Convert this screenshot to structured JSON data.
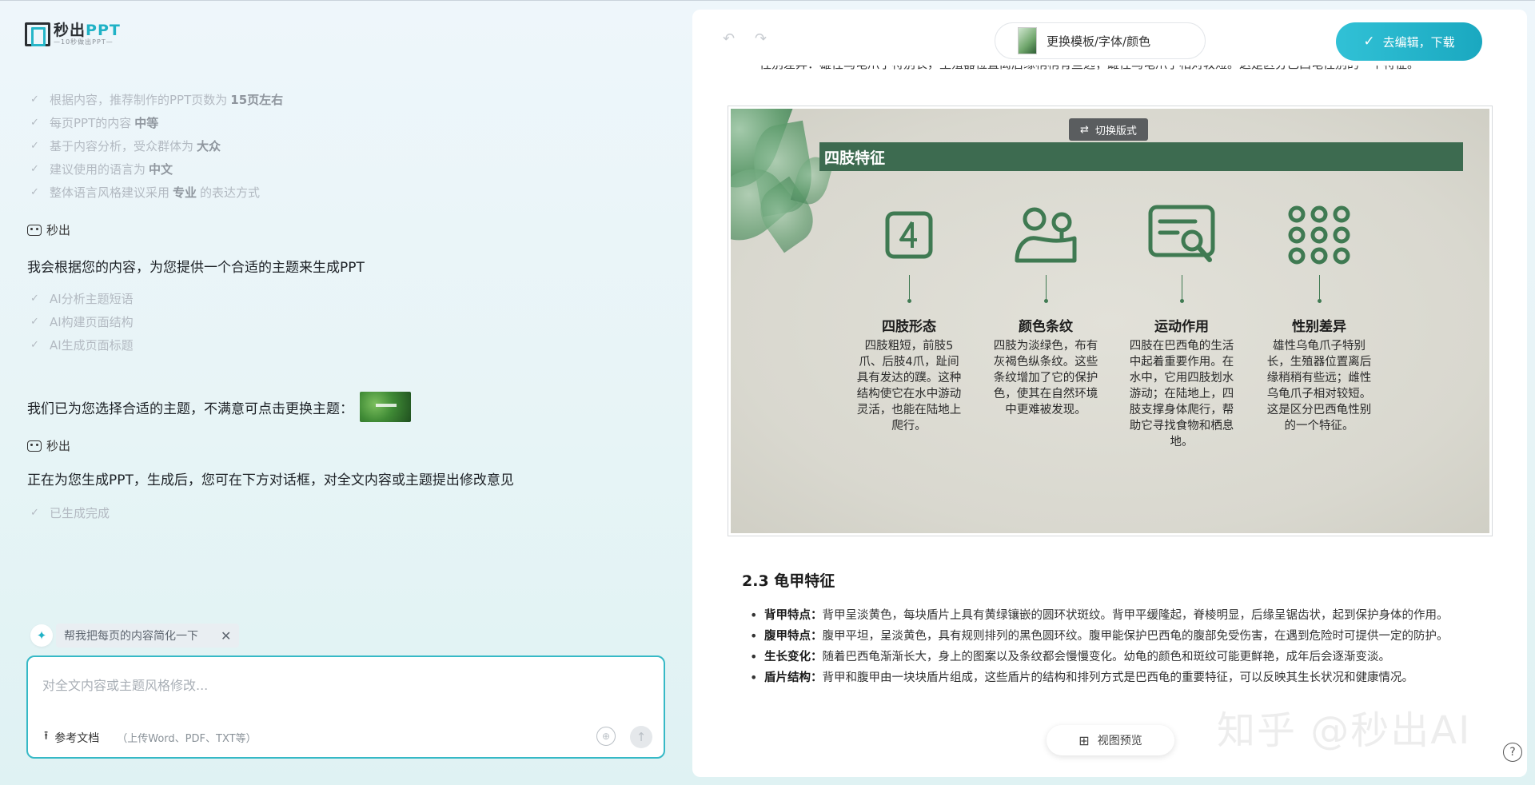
{
  "logo": {
    "main": "秒出",
    "accent": "PPT",
    "sub": "—10秒做出PPT—"
  },
  "analysis_list": [
    {
      "text_before": "根据内容，推荐制作的PPT页数为",
      "bold": "15页左右",
      "text_after": ""
    },
    {
      "text_before": "每页PPT的内容",
      "bold": "中等",
      "text_after": ""
    },
    {
      "text_before": "基于内容分析，受众群体为",
      "bold": "大众",
      "text_after": ""
    },
    {
      "text_before": "建议使用的语言为",
      "bold": "中文",
      "text_after": ""
    },
    {
      "text_before": "整体语言风格建议采用",
      "bold": "专业",
      "text_after": "的表达方式"
    }
  ],
  "bot_name": "秒出",
  "messages": {
    "theme_intro": "我会根据您的内容，为您提供一个合适的主题来生成PPT",
    "theme_chosen": "我们已为您选择合适的主题，不满意可点击更换主题：",
    "generating": "正在为您生成PPT，生成后，您可在下方对话框，对全文内容或主题提出修改意见"
  },
  "step_list": [
    "AI分析主题短语",
    "AI构建页面结构",
    "AI生成页面标题"
  ],
  "done_list": [
    "已生成完成"
  ],
  "suggestion": {
    "text": "帮我把每页的内容简化一下",
    "close": "✕"
  },
  "composer": {
    "placeholder": "对全文内容或主题风格修改...",
    "upload_label": "参考文档",
    "upload_hint": "（上传Word、PDF、TXT等）"
  },
  "toolbar": {
    "template_button": "更换模板/字体/颜色",
    "download_button": "去编辑，下载"
  },
  "doc": {
    "cut_line": "性别差异：雄性乌龟爪子特别长，生殖器位置离后缘稍稍有些远；雌性乌龟爪子相对较短。这是区分巴西龟性别的一个特征。",
    "section_heading": "2.3 龟甲特征",
    "bullets": [
      {
        "label": "背甲特点：",
        "text": "背甲呈淡黄色，每块盾片上具有黄绿镶嵌的圆环状斑纹。背甲平缓隆起，脊棱明显，后缘呈锯齿状，起到保护身体的作用。"
      },
      {
        "label": "腹甲特点：",
        "text": "腹甲平坦，呈淡黄色，具有规则排列的黑色圆环纹。腹甲能保护巴西龟的腹部免受伤害，在遇到危险时可提供一定的防护。"
      },
      {
        "label": "生长变化：",
        "text": "随着巴西龟渐渐长大，身上的图案以及条纹都会慢慢变化。幼龟的颜色和斑纹可能更鲜艳，成年后会逐渐变淡。"
      },
      {
        "label": "盾片结构：",
        "text": "背甲和腹甲由一块块盾片组成，这些盾片的结构和排列方式是巴西龟的重要特征，可以反映其生长状况和健康情况。"
      }
    ]
  },
  "slide": {
    "switch_layout": "切换版式",
    "title": "四肢特征",
    "features": [
      {
        "icon": "number-four-icon",
        "name": "四肢形态",
        "desc": "四肢粗短，前肢5爪、后肢4爪，趾间具有发达的蹼。这种结构使它在水中游动灵活，也能在陆地上爬行。"
      },
      {
        "icon": "person-tree-icon",
        "name": "颜色条纹",
        "desc": "四肢为淡绿色，布有灰褐色纵条纹。这些条纹增加了它的保护色，使其在自然环境中更难被发现。"
      },
      {
        "icon": "document-search-icon",
        "name": "运动作用",
        "desc": "四肢在巴西龟的生活中起着重要作用。在水中，它用四肢划水游动；在陆地上，四肢支撑身体爬行，帮助它寻找食物和栖息地。"
      },
      {
        "icon": "dots-grid-icon",
        "name": "性别差异",
        "desc": "雄性乌龟爪子特别长，生殖器位置离后缘稍稍有些远；雌性乌龟爪子相对较短。这是区分巴西龟性别的一个特征。"
      }
    ]
  },
  "preview_button": "视图预览",
  "watermark": "知乎 @秒出AI",
  "help": "?"
}
